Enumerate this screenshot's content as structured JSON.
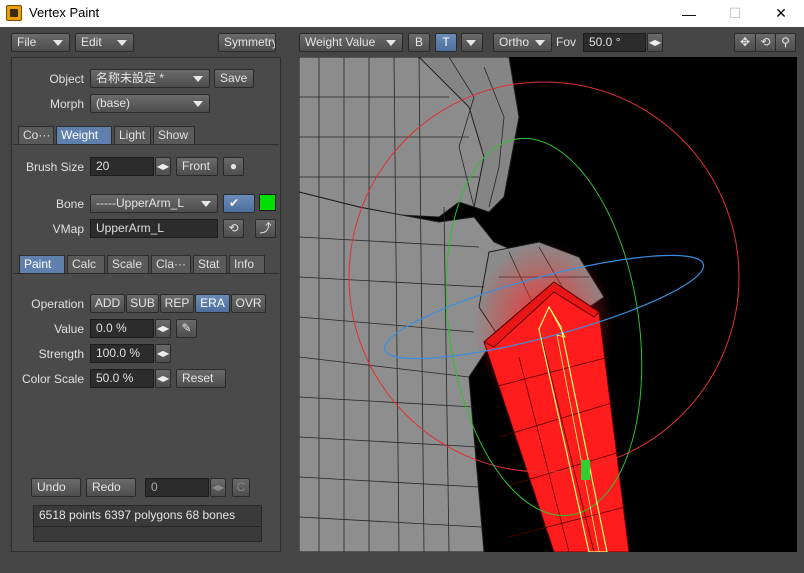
{
  "window": {
    "title": "Vertex Paint",
    "minimize": "—",
    "maximize": "☐",
    "close": "✕"
  },
  "menu": {
    "file": "File",
    "edit": "Edit",
    "symmetry": "Symmetry"
  },
  "viewport_toolbar": {
    "mode": "Weight Value",
    "b_button": "B",
    "t_button": "T",
    "projection": "Ortho",
    "fov_label": "Fov",
    "fov_value": "50.0 °"
  },
  "object_section": {
    "object_label": "Object",
    "object_value": "名称未設定 *",
    "save_button": "Save",
    "morph_label": "Morph",
    "morph_value": "(base)"
  },
  "main_tabs": [
    {
      "label": "Co···",
      "active": false
    },
    {
      "label": "Weight",
      "active": true
    },
    {
      "label": "Light",
      "active": false
    },
    {
      "label": "Show",
      "active": false
    }
  ],
  "weight_section": {
    "brush_size_label": "Brush Size",
    "brush_size_value": "20",
    "front_button": "Front",
    "bone_label": "Bone",
    "bone_value": "-----UpperArm_L",
    "bone_color": "#00e000",
    "vmap_label": "VMap",
    "vmap_value": "UpperArm_L"
  },
  "sub_tabs": [
    {
      "label": "Paint",
      "active": true
    },
    {
      "label": "Calc",
      "active": false
    },
    {
      "label": "Scale",
      "active": false
    },
    {
      "label": "Cla···",
      "active": false
    },
    {
      "label": "Stat",
      "active": false
    },
    {
      "label": "Info",
      "active": false
    }
  ],
  "paint_section": {
    "operation_label": "Operation",
    "operations": [
      {
        "label": "ADD",
        "active": false
      },
      {
        "label": "SUB",
        "active": false
      },
      {
        "label": "REP",
        "active": false
      },
      {
        "label": "ERA",
        "active": true
      },
      {
        "label": "OVR",
        "active": false
      }
    ],
    "value_label": "Value",
    "value_value": "0.0 %",
    "strength_label": "Strength",
    "strength_value": "100.0 %",
    "color_scale_label": "Color Scale",
    "color_scale_value": "50.0 %",
    "reset_button": "Reset"
  },
  "history": {
    "undo": "Undo",
    "redo": "Redo",
    "counter": "0",
    "clear": "C"
  },
  "status": {
    "text": "6518 points  6397 polygons  68 bones"
  },
  "colors": {
    "accent": "#5f7fac",
    "weight_paint": "#ff2020",
    "bone": "#ffff60",
    "ring_red": "#e03030",
    "ring_green": "#30c030",
    "ring_blue": "#3a8ee0"
  }
}
